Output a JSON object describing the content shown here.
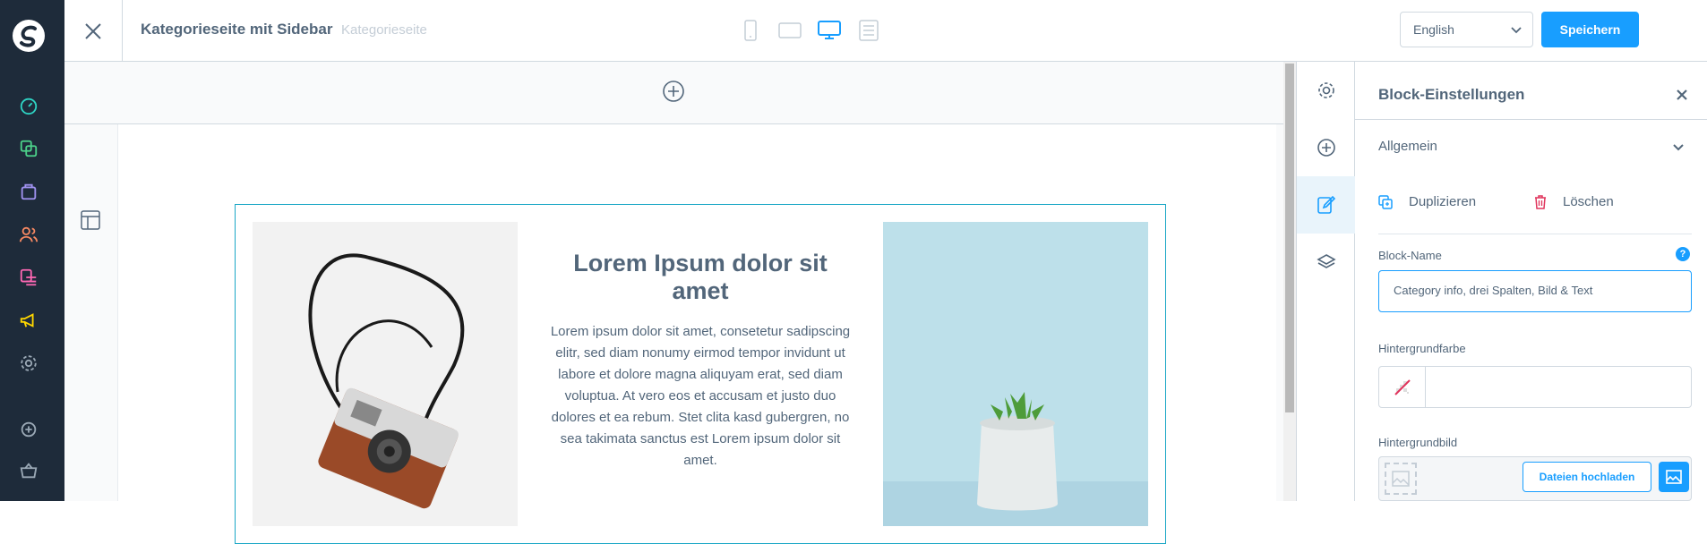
{
  "topbar": {
    "title": "Kategorieseite mit Sidebar",
    "subtitle": "Kategorieseite",
    "language": "English",
    "save_label": "Speichern"
  },
  "content": {
    "heading": "Lorem Ipsum dolor sit amet",
    "body": "Lorem ipsum dolor sit amet, consetetur sadipscing elitr, sed diam nonumy eirmod tempor invidunt ut labore et dolore magna aliquyam erat, sed diam voluptua. At vero eos et accusam et justo duo dolores et ea rebum. Stet clita kasd gubergren, no sea takimata sanctus est Lorem ipsum dolor sit amet."
  },
  "panel": {
    "title": "Block-Einstellungen",
    "section": "Allgemein",
    "duplicate_label": "Duplizieren",
    "delete_label": "Löschen",
    "block_name_label": "Block-Name",
    "block_name_value": "Category info,  drei Spalten, Bild & Text",
    "bg_color_label": "Hintergrundfarbe",
    "bg_image_label": "Hintergrundbild",
    "upload_label": "Dateien hochladen",
    "help_glyph": "?"
  },
  "colors": {
    "accent": "#189eff",
    "nav_bg": "#1e2b3a",
    "text": "#52667a"
  },
  "icons": {
    "nav": [
      "dashboard-icon",
      "catalog-icon",
      "orders-icon",
      "customers-icon",
      "content-icon",
      "marketing-icon",
      "settings-icon",
      "add-icon",
      "store-icon"
    ],
    "devices": [
      "mobile-icon",
      "tablet-icon",
      "desktop-icon",
      "list-icon"
    ],
    "sidebar_tabs": [
      "gear-icon",
      "plus-circle-icon",
      "edit-icon",
      "layers-icon"
    ]
  }
}
